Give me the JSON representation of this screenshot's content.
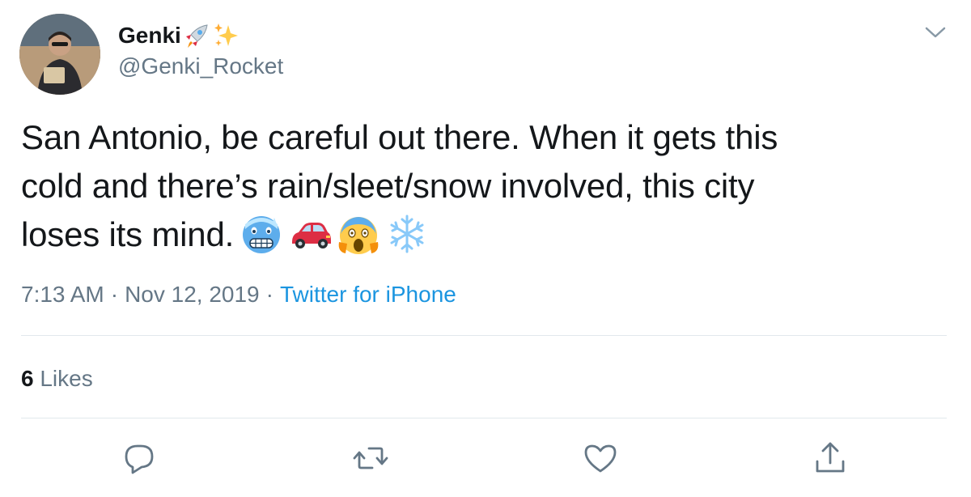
{
  "author": {
    "display_name": "Genki",
    "name_emojis": [
      "rocket-icon",
      "sparkles-icon"
    ],
    "handle": "@Genki_Rocket"
  },
  "tweet": {
    "text_lines": [
      "San Antonio, be careful out there. When it gets this",
      "cold and there’s rain/sleet/snow involved, this city",
      "loses its mind."
    ],
    "text_emojis": [
      "cold-face-emoji",
      "red-car-emoji",
      "screaming-face-emoji",
      "snowflake-emoji"
    ],
    "time": "7:13 AM",
    "separator": "·",
    "date": "Nov 12, 2019",
    "source": "Twitter for iPhone"
  },
  "stats": {
    "likes_count": "6",
    "likes_label": "Likes"
  },
  "actions": [
    "reply-icon",
    "retweet-icon",
    "like-icon",
    "share-icon"
  ],
  "colors": {
    "text": "#14171a",
    "secondary": "#657786",
    "link": "#1b95e0",
    "divider": "#e1e8ed"
  }
}
